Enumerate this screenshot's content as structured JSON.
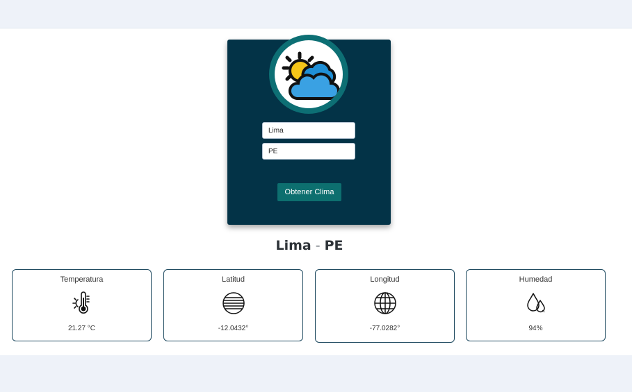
{
  "form": {
    "city_value": "Lima",
    "country_value": "PE",
    "submit_label": "Obtener Clima"
  },
  "location": {
    "city": "Lima",
    "separator": "-",
    "country": "PE"
  },
  "stats": [
    {
      "label": "Temperatura",
      "value": "21.27 °C",
      "icon": "thermometer-icon"
    },
    {
      "label": "Latitud",
      "value": "-12.0432°",
      "icon": "latitude-globe-icon"
    },
    {
      "label": "Longitud",
      "value": "-77.0282°",
      "icon": "longitude-globe-icon"
    },
    {
      "label": "Humedad",
      "value": "94%",
      "icon": "water-drops-icon"
    }
  ],
  "colors": {
    "card": "#033347",
    "accent": "#0d6f6f",
    "page_bg": "#eef2f9"
  }
}
